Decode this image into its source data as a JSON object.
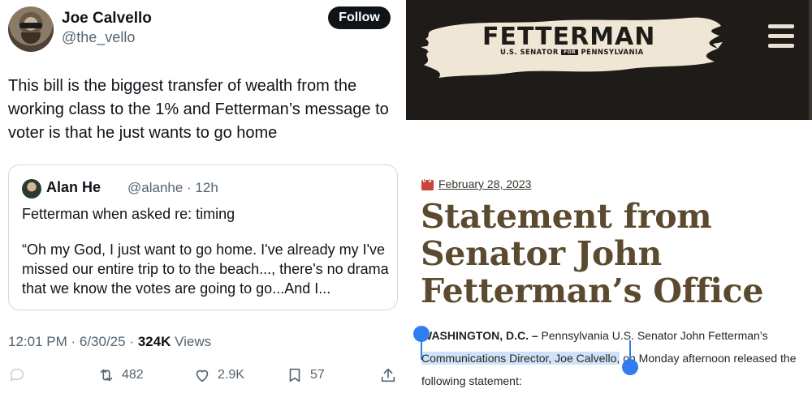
{
  "tweet": {
    "author": {
      "name": "Joe Calvello",
      "handle": "@the_vello"
    },
    "follow_label": "Follow",
    "text": "This bill is the biggest transfer of wealth from the working class to the 1% and Fetterman’s message to voter is that he just wants to go home",
    "quote": {
      "name": "Alan He",
      "meta": "@alanhe · 12h",
      "paragraphs": [
        "Fetterman when asked re: timing",
        "“Oh my God, I just want to go home. I've already my I've missed our entire trip to to the beach..., there's no drama that we know the votes are going to go...And I..."
      ]
    },
    "timestamp": "12:01 PM · 6/30/25 · ",
    "views_count": "324K",
    "views_label": " Views",
    "actions": {
      "reply_count": "",
      "retweet_count": "482",
      "like_count": "2.9K",
      "bookmark_count": "57"
    }
  },
  "site": {
    "logo": {
      "wordmark": "FETTERMAN",
      "sub_left": "U.S. SENATOR",
      "sub_for": "FOR",
      "sub_right": "PENNSYLVANIA"
    },
    "date": "February 28, 2023",
    "headline": "Statement from Senator John Fetterman’s Office",
    "body": {
      "lead": "WASHINGTON, D.C. –",
      "part1": " Pennsylvania U.S. Senator John Fetterman’s ",
      "highlight": "Communications Director, Joe Calvello,",
      "part2": " on Monday afternoon released the following statement:"
    },
    "colors": {
      "header_bg": "#1e1b18",
      "brush": "#efe6d6",
      "headline": "#5b4a2f",
      "calendar": "#c9453a",
      "selection": "#2f7ef0"
    }
  }
}
